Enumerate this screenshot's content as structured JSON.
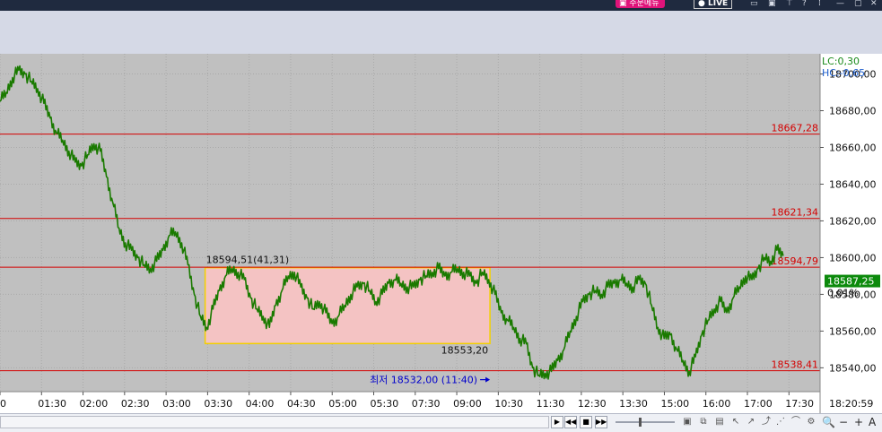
{
  "window": {
    "menu_label": "주문메뉴",
    "live_label": "LIVE"
  },
  "chart_data": {
    "type": "line",
    "series": [
      {
        "values": [
          18685,
          18690,
          18698,
          18702,
          18700,
          18696,
          18692,
          18684,
          18676,
          18668,
          18664,
          18658,
          18652,
          18650,
          18656,
          18662,
          18658,
          18644,
          18630,
          18616,
          18608,
          18604,
          18600,
          18596,
          18594,
          18598,
          18604,
          18612,
          18614,
          18608,
          18596,
          18580,
          18568,
          18562,
          18572,
          18582,
          18590,
          18594,
          18592,
          18588,
          18578,
          18572,
          18568,
          18562,
          18574,
          18582,
          18590,
          18592,
          18584,
          18578,
          18572,
          18576,
          18570,
          18564,
          18568,
          18574,
          18580,
          18584,
          18586,
          18582,
          18576,
          18580,
          18586,
          18588,
          18586,
          18584,
          18584,
          18588,
          18590,
          18592,
          18594,
          18590,
          18592,
          18594,
          18592,
          18590,
          18586,
          18592,
          18588,
          18580,
          18570,
          18566,
          18562,
          18556,
          18553,
          18540,
          18536,
          18537,
          18538,
          18544,
          18550,
          18560,
          18568,
          18576,
          18580,
          18582,
          18580,
          18584,
          18586,
          18588,
          18586,
          18584,
          18588,
          18586,
          18574,
          18562,
          18556,
          18558,
          18550,
          18544,
          18538,
          18546,
          18558,
          18566,
          18572,
          18576,
          18570,
          18578,
          18584,
          18590,
          18588,
          18594,
          18600,
          18598,
          18604,
          18601
        ]
      }
    ],
    "xticks": [
      "00",
      "01:30",
      "02:00",
      "02:30",
      "03:00",
      "03:30",
      "04:00",
      "04:30",
      "05:00",
      "05:30",
      "07:30",
      "09:00",
      "10:30",
      "11:30",
      "12:30",
      "13:30",
      "15:00",
      "16:00",
      "17:00",
      "17:30"
    ],
    "xtick_values": [
      0,
      1.5,
      2,
      2.5,
      3,
      3.5,
      4,
      4.5,
      5,
      5.5,
      7.5,
      9,
      10.5,
      11.5,
      12.5,
      13.5,
      15,
      16,
      17,
      17.5
    ],
    "x_positions": [
      0,
      1,
      2,
      3,
      4,
      5,
      6,
      7,
      8,
      9,
      10,
      11,
      12,
      13,
      14,
      15,
      16,
      17,
      18,
      19
    ],
    "x_range": [
      0,
      19.75
    ],
    "ylim": [
      18527,
      18711
    ],
    "yticks": [
      18540,
      18560,
      18580,
      18600,
      18620,
      18640,
      18660,
      18680,
      18700
    ],
    "ytick_labels": [
      "18540,00",
      "18560,00",
      "18580,00",
      "18600,00",
      "18620,00",
      "18640,00",
      "18660,00",
      "18680,00",
      "18700,00"
    ],
    "hlines": [
      {
        "value": 18667.28,
        "label": "18667,28"
      },
      {
        "value": 18621.34,
        "label": "18621,34"
      },
      {
        "value": 18594.79,
        "label": "18594,79"
      },
      {
        "value": 18538.41,
        "label": "18538,41"
      }
    ],
    "box": {
      "x_from": 4.94,
      "x_to": 11.8,
      "y_low": 18553.2,
      "y_high": 18594.51,
      "top_label": "18594,51(41,31)",
      "bottom_label": "18553,20"
    },
    "low_annotation": {
      "label": "최저 18532,00 (11:40)",
      "x": 11.8,
      "y": 18538.41
    },
    "indicators": {
      "lc": "LC:0,30",
      "hc": "HC:-0,65"
    },
    "current_price": {
      "value": 18587.25,
      "label": "18587,25",
      "change": "0,01%"
    },
    "time_label": "18:20:59",
    "grid": true,
    "background": "#c0c0c0",
    "line_color": "#1a7a00",
    "level_color": "#d40000",
    "box_fill": "#f4c3c3",
    "box_border": "#f2d000",
    "annotation_color": "#0000cc"
  }
}
